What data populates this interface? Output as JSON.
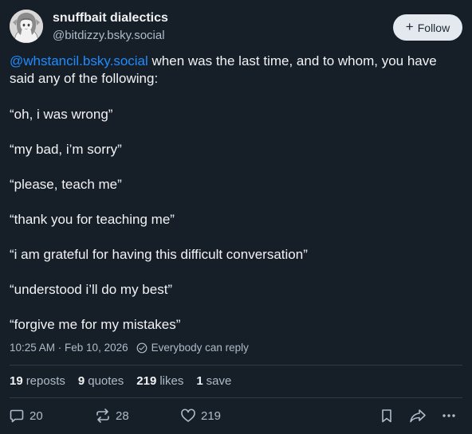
{
  "author": {
    "display_name": "snuffbait dialectics",
    "handle": "@bitdizzy.bsky.social",
    "avatar_icon": "anime-avatar"
  },
  "follow_button": {
    "plus": "+",
    "label": "Follow"
  },
  "post": {
    "mention": "@whstancil.bsky.social",
    "intro_rest": " when was the last time, and to whom, you have said any of the following:",
    "quotes": [
      "“oh, i was wrong”",
      "“my bad, i’m sorry”",
      "“please, teach me”",
      "“thank you for teaching me”",
      "“i am grateful for having this difficult conversation”",
      "“understood i’ll do my best”",
      "“forgive me for my mistakes”"
    ]
  },
  "meta": {
    "timestamp": "10:25 AM · Feb 10, 2026",
    "reply_setting": "Everybody can reply"
  },
  "stats": {
    "reposts_count": "19",
    "reposts_label": "reposts",
    "quotes_count": "9",
    "quotes_label": "quotes",
    "likes_count": "219",
    "likes_label": "likes",
    "saves_count": "1",
    "saves_label": "save"
  },
  "actions": {
    "replies": "20",
    "reposts": "28",
    "likes": "219"
  },
  "colors": {
    "background": "#161e27",
    "text": "#f1f3f5",
    "muted": "#aebbc9",
    "link": "#208bfe",
    "follow_button_bg": "#e3e9ef"
  }
}
